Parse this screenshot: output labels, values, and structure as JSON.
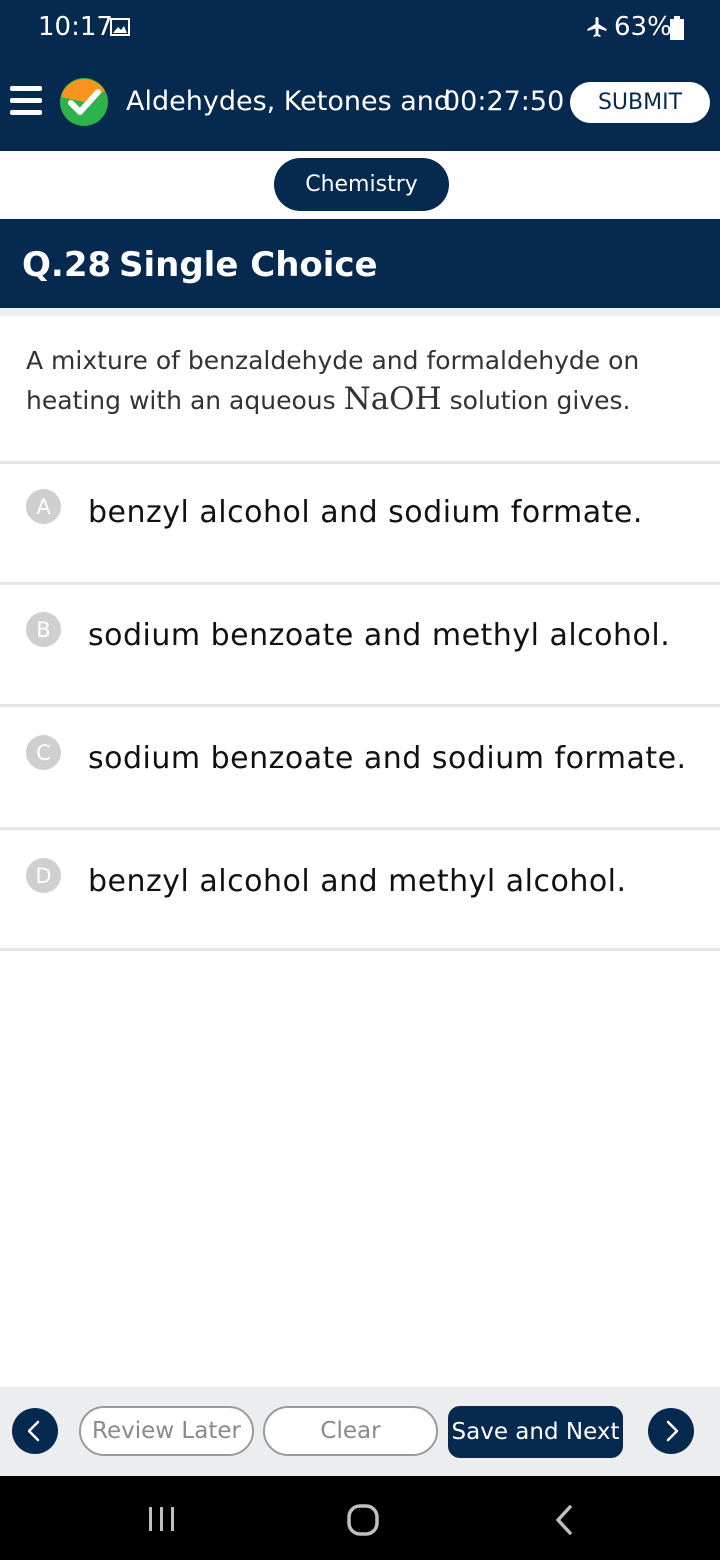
{
  "status_bar": {
    "time": "10:17",
    "battery": "63%"
  },
  "header": {
    "title": "Aldehydes, Ketones and",
    "timer": "00:27:50",
    "submit_label": "SUBMIT"
  },
  "subject": "Chemistry",
  "question": {
    "number": "Q.28",
    "type": "Single Choice",
    "text_before": "A mixture of benzaldehyde and formaldehyde on heating with an aqueous ",
    "math": "NaOH",
    "text_after": " solution gives."
  },
  "options": [
    {
      "letter": "A",
      "text": "benzyl alcohol and sodium formate."
    },
    {
      "letter": "B",
      "text": "sodium benzoate and methyl alcohol."
    },
    {
      "letter": "C",
      "text": "sodium benzoate and sodium formate."
    },
    {
      "letter": "D",
      "text": "benzyl alcohol and methyl alcohol."
    }
  ],
  "actions": {
    "review_later": "Review Later",
    "clear": "Clear",
    "save_next": "Save and Next"
  },
  "colors": {
    "primary": "#05294f",
    "option_badge": "#cfcfcf",
    "logo_green": "#2db34a",
    "logo_orange": "#f7941d"
  },
  "icons": [
    "gallery-icon",
    "airplane-icon",
    "battery-icon",
    "menu-icon",
    "chevron-left-icon",
    "chevron-right-icon",
    "recent-apps-icon",
    "home-icon",
    "back-icon"
  ]
}
